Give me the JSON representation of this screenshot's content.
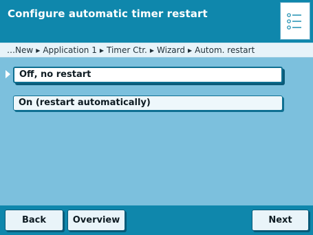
{
  "header": {
    "title": "Configure automatic timer restart",
    "menu_icon": "list-menu-icon"
  },
  "breadcrumb": {
    "items": [
      "…New",
      "Application 1",
      "Timer Ctr.",
      "Wizard",
      "Autom. restart"
    ],
    "separator": "▶"
  },
  "options": {
    "items": [
      {
        "label": "Off, no restart",
        "selected": true
      },
      {
        "label": "On (restart automatically)",
        "selected": false
      }
    ]
  },
  "footer": {
    "back_label": "Back",
    "overview_label": "Overview",
    "next_label": "Next"
  },
  "colors": {
    "titlebar": "#0f87ac",
    "background": "#7cc0dd",
    "button_face": "#e9f4f9",
    "border": "#0e6f91"
  }
}
